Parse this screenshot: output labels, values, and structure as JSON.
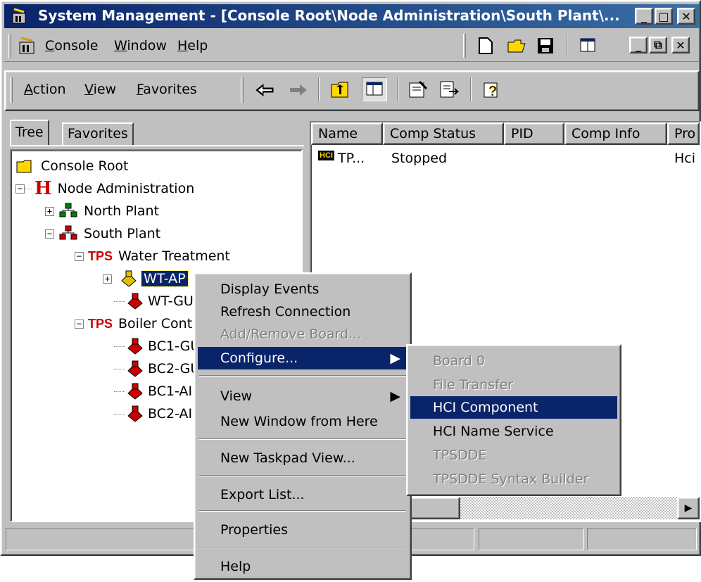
{
  "title": "System Management - [Console Root\\Node Administration\\South Plant\\...",
  "menubar": {
    "console": "Console",
    "window": "Window",
    "help": "Help"
  },
  "actionbar": {
    "action": "Action",
    "view": "View",
    "favorites": "Favorites"
  },
  "tabs": {
    "tree": "Tree",
    "favorites": "Favorites"
  },
  "tree": {
    "console_root": "Console Root",
    "node_admin": "Node Administration",
    "north_plant": "North Plant",
    "south_plant": "South Plant",
    "tps_badge": "TPS",
    "water_treatment": "Water Treatment",
    "wt_ap": "WT-AP",
    "wt_gu": "WT-GU",
    "boiler": "Boiler Cont",
    "bc1_gu": "BC1-GU",
    "bc2_gu": "BC2-GU",
    "bc1_ap": "BC1-AI",
    "bc2_ap": "BC2-AI"
  },
  "list": {
    "columns": [
      "Name",
      "Comp Status",
      "PID",
      "Comp Info",
      "Pro"
    ],
    "rows": [
      {
        "icon_label": "HCI",
        "name": "TP...",
        "status": "Stopped",
        "pid": "",
        "info": "",
        "pro": "Hci"
      }
    ]
  },
  "context_menu": {
    "items": [
      "Display Events",
      "Refresh Connection",
      "Add/Remove Board...",
      "Configure...",
      "View",
      "New Window from Here",
      "New Taskpad View...",
      "Export List...",
      "Properties",
      "Help"
    ]
  },
  "submenu": {
    "items": [
      "Board 0",
      "File Transfer",
      "HCI Component",
      "HCI Name Service",
      "TPSDDE",
      "TPSDDE Syntax Builder"
    ]
  },
  "colors": {
    "titlebar": "#0a246a",
    "selection": "#0a246a",
    "face": "#c0c0c0",
    "tps_red": "#cc0000"
  }
}
